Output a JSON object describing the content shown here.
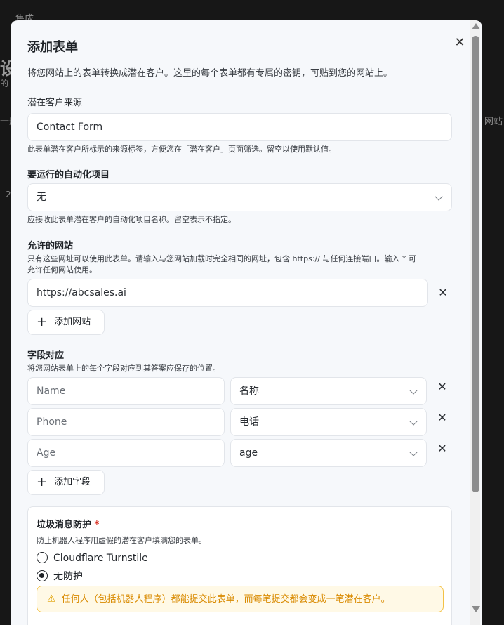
{
  "background": {
    "breadcrumb": "集成",
    "heading": "设",
    "sub": "的",
    "tab_left": "一般",
    "tab_right": "网站",
    "misc": "2"
  },
  "modal": {
    "title": "添加表单",
    "close_icon": "close-icon",
    "description": "将您网站上的表单转换成潜在客户。这里的每个表单都有专属的密钥，可贴到您的网站上。",
    "lead_source": {
      "label": "潜在客户来源",
      "value": "Contact Form",
      "hint": "此表单潜在客户所标示的来源标签，方便您在「潜在客户」页面筛选。留空以使用默认值。"
    },
    "automation": {
      "label": "要运行的自动化项目",
      "value": "无",
      "hint": "应接收此表单潜在客户的自动化项目名称。留空表示不指定。"
    },
    "allowed_sites": {
      "label": "允许的网站",
      "hint_line1": "只有这些网址可以使用此表单。请输入与您网站加载时完全相同的网址，包含 https:// 与任何连接端口。输入 * 可",
      "hint_line2": "允许任何网站使用。",
      "sites": [
        "https://abcsales.ai"
      ],
      "add_label": "添加网站"
    },
    "field_mapping": {
      "label": "字段对应",
      "hint": "将您网站表单上的每个字段对应到其答案应保存的位置。",
      "rows": [
        {
          "source": "Name",
          "target": "名称"
        },
        {
          "source": "Phone",
          "target": "电话"
        },
        {
          "source": "Age",
          "target": "age"
        }
      ],
      "add_label": "添加字段"
    },
    "spam": {
      "label": "垃圾消息防护",
      "required_mark": "*",
      "hint": "防止机器人程序用虚假的潜在客户填满您的表单。",
      "options": [
        {
          "label": "Cloudflare Turnstile",
          "selected": false
        },
        {
          "label": "无防护",
          "selected": true
        }
      ],
      "warning": "任何人（包括机器人程序）都能提交此表单，而每笔提交都会变成一笔潜在客户。"
    }
  },
  "colors": {
    "backdrop": "#171717",
    "modal_bg": "#f6f8fb",
    "warning_text": "#d98a00",
    "warning_bg": "#fff9e6",
    "required": "#d92d20"
  }
}
